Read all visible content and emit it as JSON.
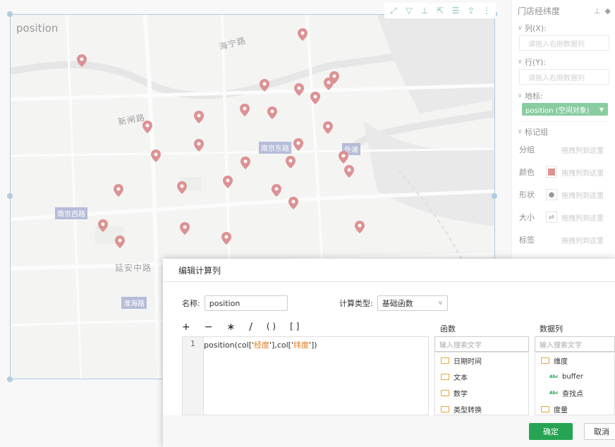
{
  "map": {
    "title": "position",
    "labels": {
      "haining": "海宁路",
      "xinzha": "新闸路",
      "yanan": "延安中路"
    },
    "tags": {
      "nanjing_east": "南京东路",
      "waitan": "外滩",
      "nanjing_west": "南京西路",
      "huaihai": "淮海路"
    }
  },
  "toolbar": {
    "icons": [
      "fullscreen-icon",
      "filter-icon",
      "axis-icon",
      "export-icon",
      "list-icon",
      "share-icon",
      "more-icon"
    ]
  },
  "panel": {
    "title": "门店经纬度",
    "columns_label": "列(X):",
    "columns_placeholder": "请拖入右侧数据列",
    "rows_label": "行(Y):",
    "rows_placeholder": "请拖入右侧数据列",
    "geo_label": "地标:",
    "geo_chip": "position (空间对象)",
    "marks_label": "标记组",
    "mark_rows": [
      {
        "label": "分组",
        "hint": "拖拽列到这里"
      },
      {
        "label": "颜色",
        "hint": "拖拽列到这里"
      },
      {
        "label": "形状",
        "hint": "拖拽列到这里"
      },
      {
        "label": "大小",
        "hint": "拖拽列到这里"
      },
      {
        "label": "标签",
        "hint": "拖拽列到这里"
      }
    ],
    "color_swatch": "#c0393b"
  },
  "dialog": {
    "title": "编辑计算列",
    "name_label": "名称:",
    "name_value": "position",
    "calc_type_label": "计算类型:",
    "calc_type_value": "基础函数",
    "operators": [
      "+",
      "−",
      "∗",
      "/",
      "( )",
      "[ ]"
    ],
    "editor": {
      "line_number": "1",
      "code_prefix": "position(col['",
      "arg1": "经度",
      "code_mid": "'],col['",
      "arg2": "纬度",
      "code_suffix": "'])"
    },
    "functions": {
      "heading": "函数",
      "search_placeholder": "输入搜索文字",
      "items": [
        "日期时间",
        "文本",
        "数学",
        "类型转换"
      ]
    },
    "data_columns": {
      "heading": "数据列",
      "search_placeholder": "输入搜索文字",
      "items": [
        {
          "type": "folder",
          "label": "维度"
        },
        {
          "type": "abc",
          "label": "buffer"
        },
        {
          "type": "abc",
          "label": "查找点"
        },
        {
          "type": "folder",
          "label": "度量"
        }
      ]
    },
    "ok_label": "确定",
    "cancel_label": "取消"
  }
}
